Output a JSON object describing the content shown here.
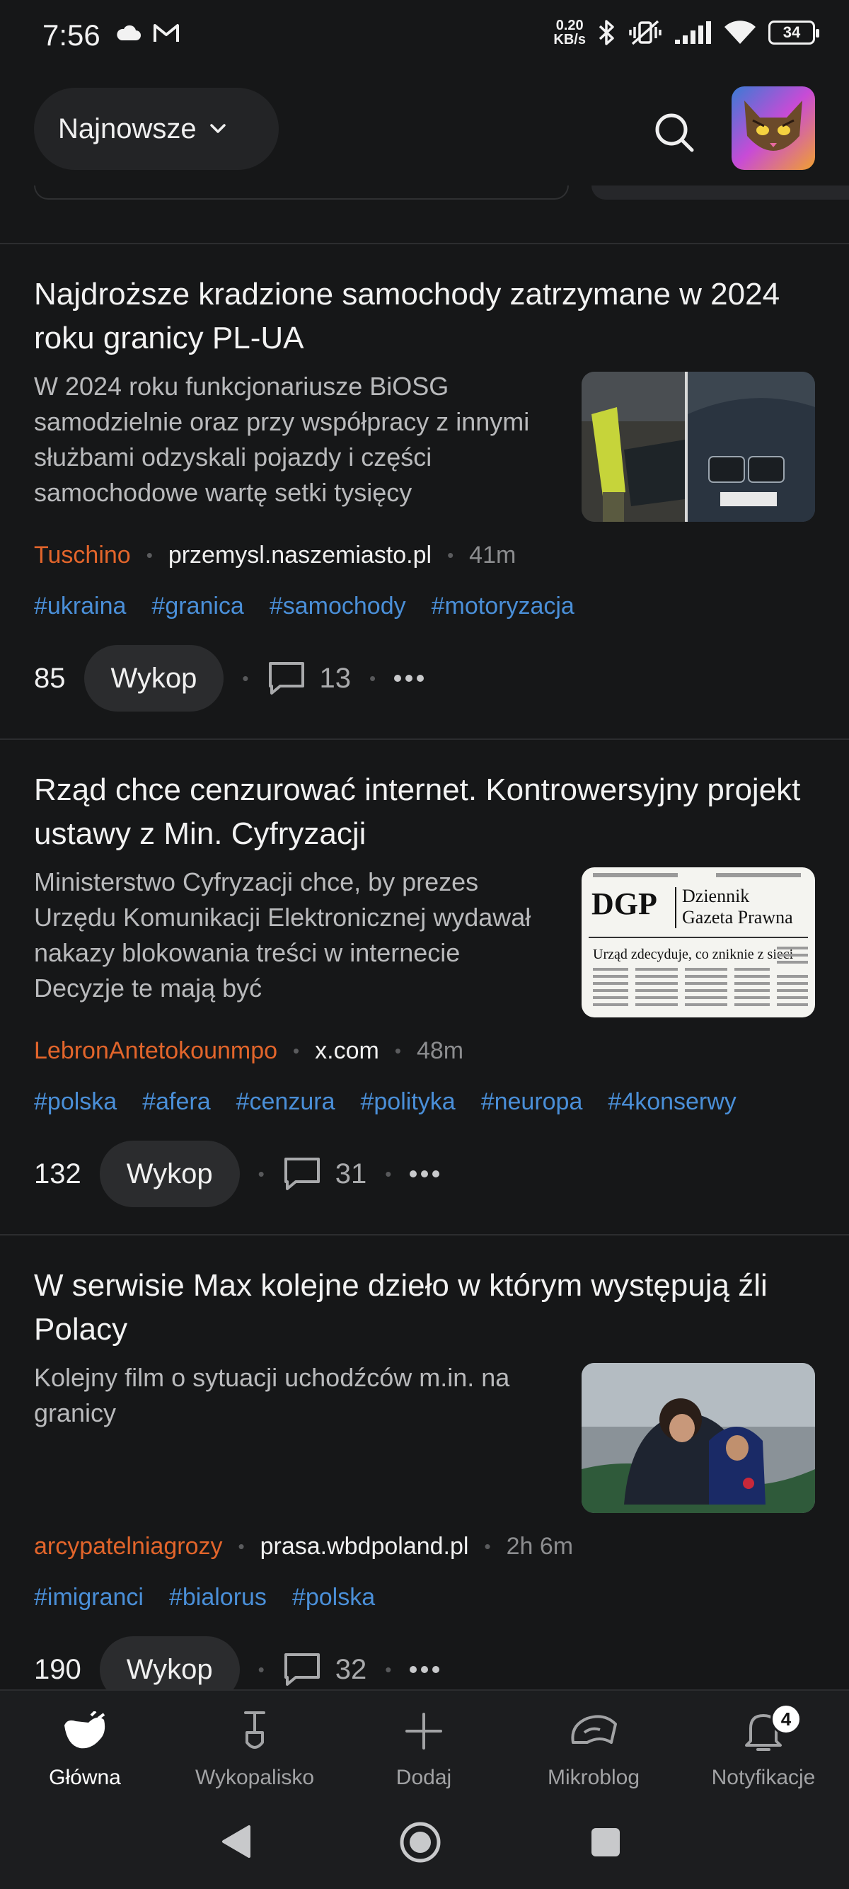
{
  "status": {
    "time": "7:56",
    "netspeed_value": "0.20",
    "netspeed_unit": "KB/s",
    "battery": "34"
  },
  "header": {
    "sort_label": "Najnowsze"
  },
  "articles": [
    {
      "title": "Najdroższe kradzione samochody zatrzymane w 2024 roku granicy PL-UA",
      "description": "W 2024 roku funkcjonariusze BiOSG samodzielnie oraz przy współpracy z innymi służbami odzyskali pojazdy i części samochodowe wartę setki tysięcy",
      "author": "Tuschino",
      "source": "przemysl.naszemiasto.pl",
      "time": "41m",
      "tags": [
        "#ukraina",
        "#granica",
        "#samochody",
        "#motoryzacja"
      ],
      "votes": "85",
      "wykop_label": "Wykop",
      "comments": "13"
    },
    {
      "title": "Rząd chce cenzurować internet. Kontrowersyjny projekt ustawy z Min. Cyfryzacji",
      "description": "Ministerstwo Cyfryzacji chce, by prezes Urzędu Komunikacji Elektronicznej wydawał nakazy blokowania treści w internecie Decyzje te mają być",
      "author": "LebronAntetokounmpo",
      "source": "x.com",
      "time": "48m",
      "tags": [
        "#polska",
        "#afera",
        "#cenzura",
        "#polityka",
        "#neuropa",
        "#4konserwy"
      ],
      "votes": "132",
      "wykop_label": "Wykop",
      "comments": "31",
      "thumb_text": {
        "brand": "DGP",
        "name_line1": "Dziennik",
        "name_line2": "Gazeta Prawna",
        "headline": "Urząd zdecyduje, co zniknie z sieci"
      }
    },
    {
      "title": "W serwisie Max kolejne dzieło w którym występują źli Polacy",
      "description": "Kolejny film o sytuacji uchodźców m.in. na granicy",
      "author": "arcypatelniagrozy",
      "source": "prasa.wbdpoland.pl",
      "time": "2h 6m",
      "tags": [
        "#imigranci",
        "#bialorus",
        "#polska"
      ],
      "votes": "190",
      "wykop_label": "Wykop",
      "comments": "32"
    }
  ],
  "nav": {
    "home": "Główna",
    "digs": "Wykopalisko",
    "add": "Dodaj",
    "microblog": "Mikroblog",
    "notifications": "Notyfikacje",
    "notifications_badge": "4"
  },
  "colors": {
    "background": "#161718",
    "author": "#e2652b",
    "tag": "#4a8fd8"
  }
}
